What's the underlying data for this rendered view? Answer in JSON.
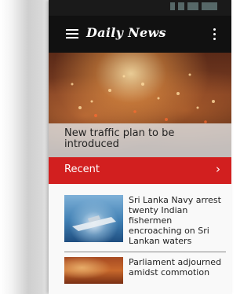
{
  "app": {
    "title": "Daily News"
  },
  "hero": {
    "title": "New traffic plan to be introduced"
  },
  "recent": {
    "label": "Recent",
    "chevron": "›"
  },
  "news": [
    {
      "title": "Sri Lanka Navy arrest twenty Indian fishermen encroaching on Sri Lankan waters",
      "thumb": "navy-boat-photo"
    },
    {
      "title": "Parliament adjourned amidst commotion",
      "thumb": "parliament-photo"
    }
  ],
  "icons": {
    "menu": "hamburger-menu-icon",
    "overflow": "more-vert-icon"
  },
  "colors": {
    "app_bar": "#111111",
    "accent": "#d21f1f"
  }
}
